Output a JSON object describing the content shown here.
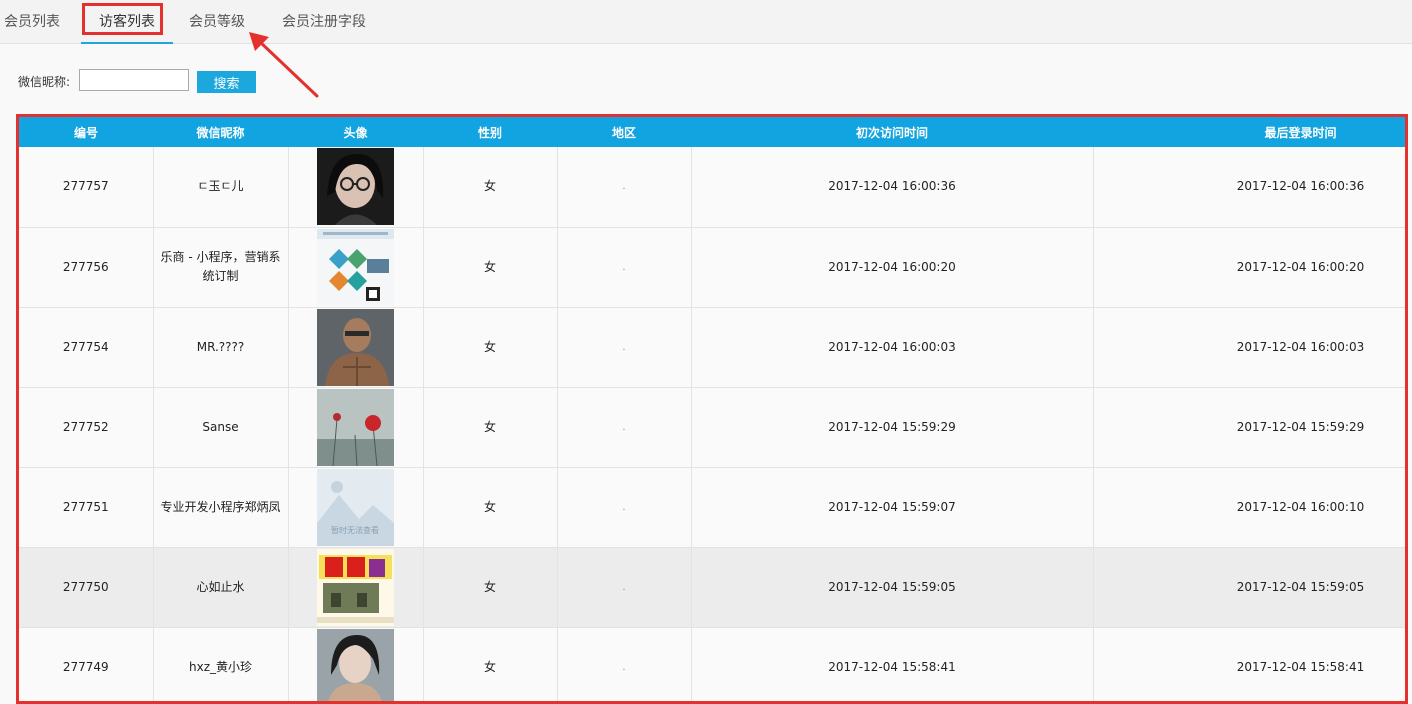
{
  "tabs": [
    {
      "label": "会员列表",
      "active": false
    },
    {
      "label": "访客列表",
      "active": true
    },
    {
      "label": "会员等级",
      "active": false
    },
    {
      "label": "会员注册字段",
      "active": false
    }
  ],
  "search": {
    "label": "微信昵称:",
    "value": "",
    "button_label": "搜索"
  },
  "table": {
    "headers": [
      "编号",
      "微信昵称",
      "头像",
      "性别",
      "地区",
      "初次访问时间",
      "最后登录时间"
    ],
    "rows": [
      {
        "id": "277757",
        "nickname": "ㄷ玉ㄷ儿",
        "avatar": "girl-with-glasses-photo",
        "gender": "女",
        "region": ".",
        "first_visit": "2017-12-04 16:00:36",
        "last_login": "2017-12-04 16:00:36"
      },
      {
        "id": "277756",
        "nickname": "乐商 - 小程序，营销系统订制",
        "avatar": "promo-poster-image",
        "gender": "女",
        "region": ".",
        "first_visit": "2017-12-04 16:00:20",
        "last_login": "2017-12-04 16:00:20"
      },
      {
        "id": "277754",
        "nickname": "MR.????",
        "avatar": "muscleman-cartoon-image",
        "gender": "女",
        "region": ".",
        "first_visit": "2017-12-04 16:00:03",
        "last_login": "2017-12-04 16:00:03"
      },
      {
        "id": "277752",
        "nickname": "Sanse",
        "avatar": "red-flower-photo",
        "gender": "女",
        "region": ".",
        "first_visit": "2017-12-04 15:59:29",
        "last_login": "2017-12-04 15:59:29"
      },
      {
        "id": "277751",
        "nickname": "专业开发小程序郑炳凤",
        "avatar": "placeholder-image",
        "placeholder_caption": "暂时无法查看",
        "gender": "女",
        "region": ".",
        "first_visit": "2017-12-04 15:59:07",
        "last_login": "2017-12-04 16:00:10"
      },
      {
        "id": "277750",
        "nickname": "心如止水",
        "avatar": "company-logo-image",
        "gender": "女",
        "region": ".",
        "first_visit": "2017-12-04 15:59:05",
        "last_login": "2017-12-04 15:59:05",
        "highlighted": true
      },
      {
        "id": "277749",
        "nickname": "hxz_黄小珍",
        "avatar": "woman-portrait-photo",
        "gender": "女",
        "region": ".",
        "first_visit": "2017-12-04 15:58:41",
        "last_login": "2017-12-04 15:58:41"
      }
    ]
  },
  "colors": {
    "accent": "#1ca8dd",
    "header_bg": "#12a4e0",
    "annotation": "#e5312e"
  }
}
